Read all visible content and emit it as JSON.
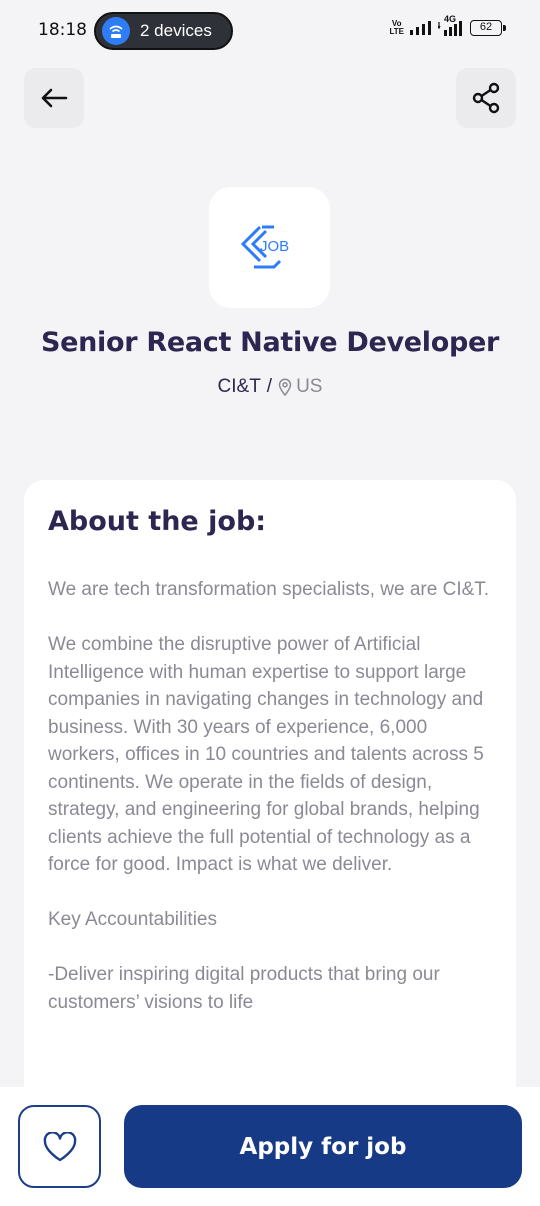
{
  "status_bar": {
    "time": "18:18",
    "hotspot_label": "2 devices",
    "volte_top": "Vo",
    "volte_bottom": "LTE",
    "network": "4G",
    "battery": "62"
  },
  "header": {
    "back_icon": "arrow-left-icon",
    "share_icon": "share-icon"
  },
  "job": {
    "logo_text": "JOB",
    "title": "Senior React Native Developer",
    "company": "CI&T",
    "separator": "/",
    "location": "US"
  },
  "about": {
    "heading": "About the job:",
    "paragraphs": [
      "We are tech transformation specialists, we are CI&T.",
      "We combine the disruptive power of Artificial Intelligence with human expertise to support large companies in navigating changes in technology and business. With 30 years of experience, 6,000 workers, offices in 10 countries and talents across 5 continents. We operate in the fields of design, strategy, and engineering for global brands, helping clients achieve the full potential of technology as a force for good. Impact is what we deliver.",
      "Key Accountabilities",
      "-Deliver inspiring digital products that bring our customers’ visions to life"
    ]
  },
  "actions": {
    "favorite_icon": "heart-icon",
    "apply_label": "Apply for job"
  },
  "colors": {
    "primary": "#173a86",
    "title": "#2d2650",
    "body_text": "#8a8a94",
    "logo_blue": "#2f7df6"
  }
}
